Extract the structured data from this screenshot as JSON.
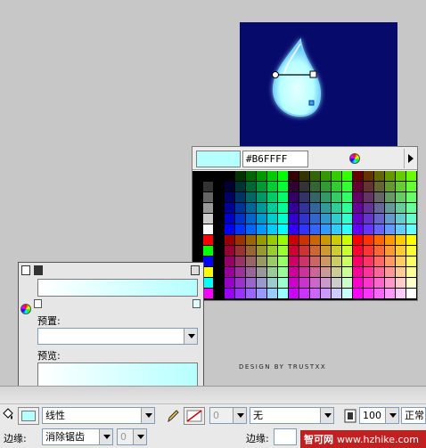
{
  "swatch_popup": {
    "hex_value": "#B6FFFF",
    "preview_color": "#b6ffff"
  },
  "fill_panel": {
    "preset_label": "预置:",
    "preview_label": "预览:",
    "gradient_start": "#ffffff",
    "gradient_end": "#b6ffff"
  },
  "credit": {
    "text": "DESIGN BY TRUSTXX"
  },
  "property_inspector": {
    "fill_color": "#b6ffff",
    "fill_type": "线性",
    "stroke_width": "0",
    "stroke_style": "无",
    "zoom": "100",
    "blend_mode": "正常",
    "edge_label": "边缘:",
    "edge_value": "消除锯齿",
    "edge_number": "0",
    "edge_label_2": "边缘:"
  },
  "watermark": {
    "brand": "智可网",
    "url": "www.hzhike.com"
  }
}
